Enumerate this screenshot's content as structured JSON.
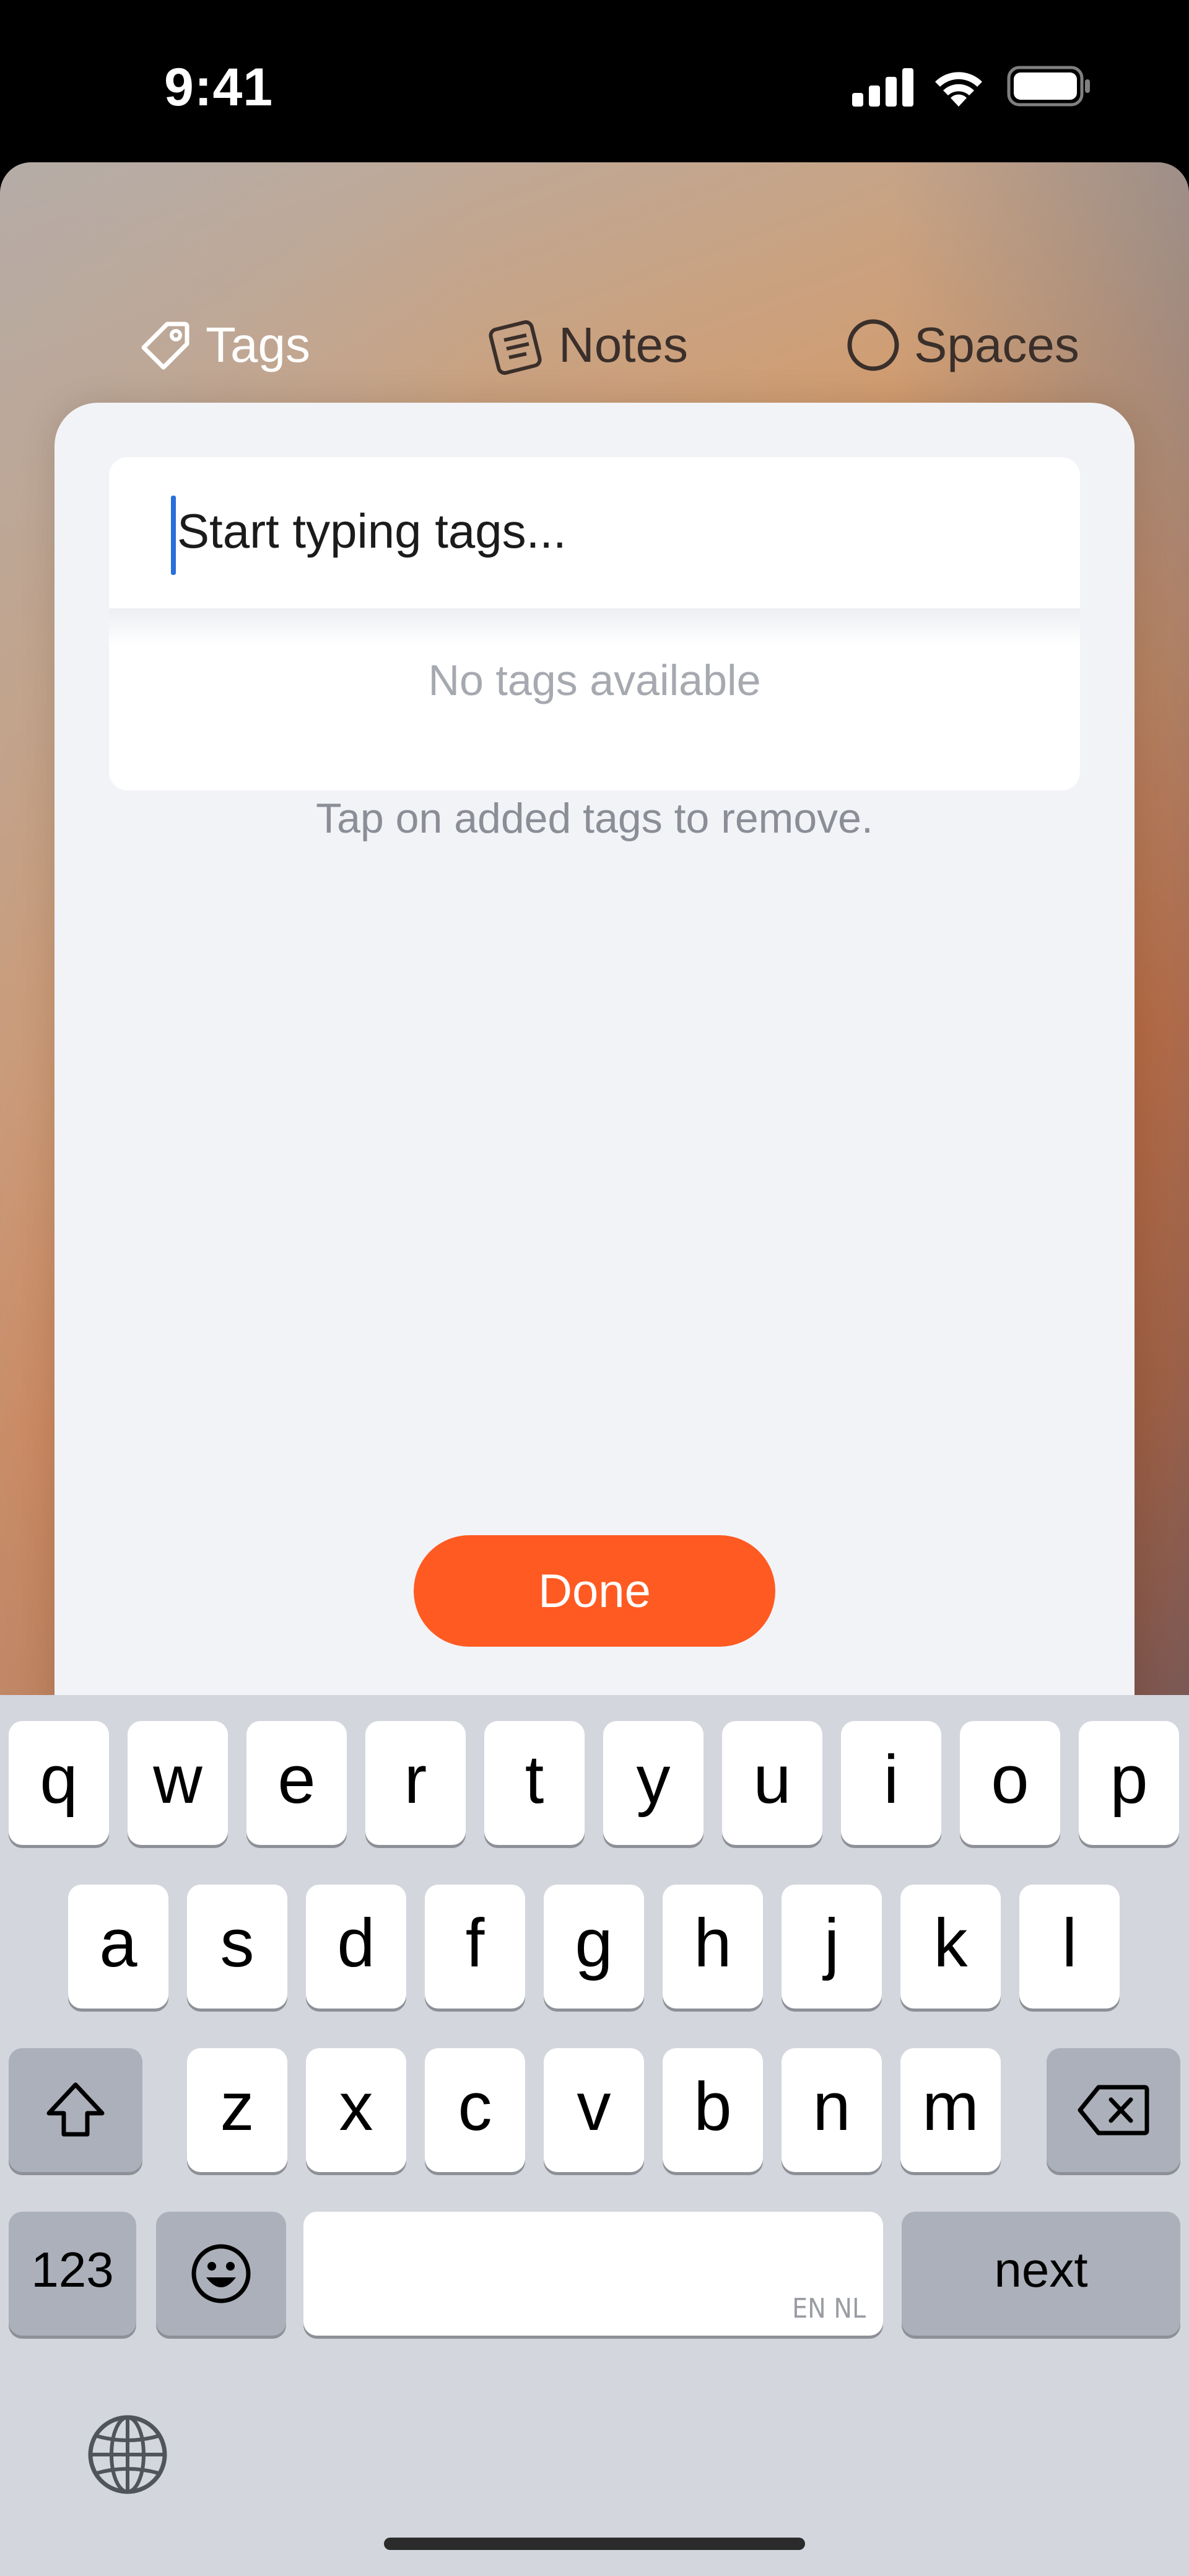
{
  "status_bar": {
    "time": "9:41"
  },
  "nav": {
    "tags_label": "Tags",
    "notes_label": "Notes",
    "spaces_label": "Spaces"
  },
  "tag_editor": {
    "input_placeholder": "Start typing tags...",
    "empty_message": "No tags available",
    "hint": "Tap on added tags to remove.",
    "done_label": "Done"
  },
  "keyboard": {
    "row1": [
      "q",
      "w",
      "e",
      "r",
      "t",
      "y",
      "u",
      "i",
      "o",
      "p"
    ],
    "row2": [
      "a",
      "s",
      "d",
      "f",
      "g",
      "h",
      "j",
      "k",
      "l"
    ],
    "row3": [
      "z",
      "x",
      "c",
      "v",
      "b",
      "n",
      "m"
    ],
    "numbers_label": "123",
    "space_lang": "EN NL",
    "return_label": "next"
  },
  "colors": {
    "accent": "#ff5a22",
    "caret": "#2a6fdb"
  }
}
